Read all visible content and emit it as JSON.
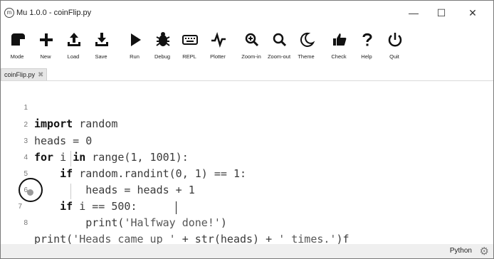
{
  "window": {
    "title": "Mu 1.0.0 - coinFlip.py",
    "icon": "mu-icon",
    "controls": {
      "minimize": "—",
      "maximize": "☐",
      "close": "✕"
    }
  },
  "toolbar": {
    "buttons": [
      {
        "id": "mode",
        "label": "Mode",
        "icon": "mode-icon"
      },
      {
        "id": "new",
        "label": "New",
        "icon": "plus-icon"
      },
      {
        "id": "load",
        "label": "Load",
        "icon": "upload-icon"
      },
      {
        "id": "save",
        "label": "Save",
        "icon": "download-icon"
      },
      {
        "id": "run",
        "label": "Run",
        "icon": "play-icon"
      },
      {
        "id": "debug",
        "label": "Debug",
        "icon": "bug-icon"
      },
      {
        "id": "repl",
        "label": "REPL",
        "icon": "keyboard-icon"
      },
      {
        "id": "plotter",
        "label": "Plotter",
        "icon": "pulse-icon"
      },
      {
        "id": "zoom-in",
        "label": "Zoom-in",
        "icon": "zoom-in-icon"
      },
      {
        "id": "zoom-out",
        "label": "Zoom-out",
        "icon": "zoom-out-icon"
      },
      {
        "id": "theme",
        "label": "Theme",
        "icon": "moon-icon"
      },
      {
        "id": "check",
        "label": "Check",
        "icon": "thumbs-up-icon"
      },
      {
        "id": "help",
        "label": "Help",
        "icon": "question-icon"
      },
      {
        "id": "quit",
        "label": "Quit",
        "icon": "power-icon"
      }
    ]
  },
  "tab": {
    "label": "coinFlip.py",
    "close": "✖"
  },
  "editor": {
    "lines": [
      {
        "n": "1",
        "t1": "import",
        "t2": " random"
      },
      {
        "n": "2",
        "t1": "heads = 0"
      },
      {
        "n": "3",
        "t1": "for",
        "t2": " i ",
        "t3": "in",
        "t4": " range(1, 1001):"
      },
      {
        "n": "4",
        "t1": "    ",
        "t2": "if",
        "t3": " random.randint(0, 1) == 1:"
      },
      {
        "n": "5",
        "t1": "        heads = heads + 1"
      },
      {
        "n": "6",
        "t1": "    ",
        "t2": "if",
        "t3": " i == 500:"
      },
      {
        "n": "7",
        "t1": "        print(",
        "t2": "'Halfway done!'",
        "t3": ")"
      },
      {
        "n": "8",
        "t1": "print(",
        "t2": "'Heads came up '",
        "t3": " + str(heads) + ",
        "t4": "' times.'",
        "t5": ")f"
      }
    ]
  },
  "status": {
    "mode": "Python",
    "settings_icon": "gear-icon"
  }
}
